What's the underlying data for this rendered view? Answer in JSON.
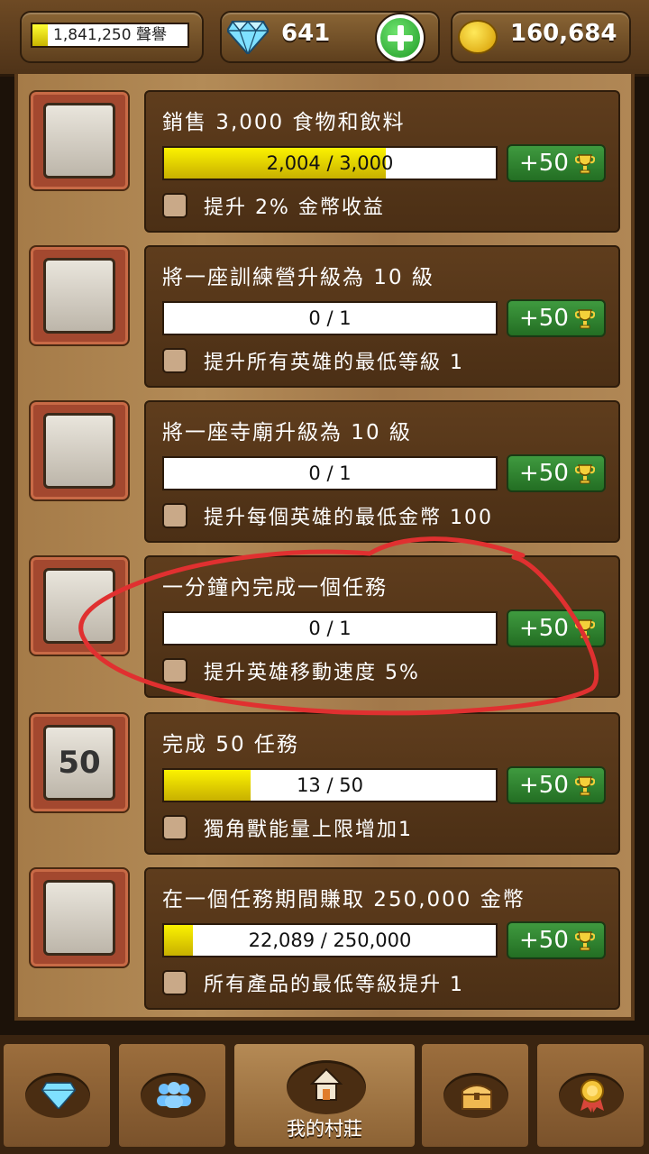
{
  "hud": {
    "reputation_text": "1,841,250 聲譽",
    "reputation_fill": 0.1,
    "gems": "641",
    "gold": "160,684",
    "gem_icon": "diamond-icon",
    "add_icon": "plus-icon",
    "gold_icon": "coin-icon"
  },
  "achievements": [
    {
      "icon": "beer-and-drumstick-icon",
      "title": "銷售 3,000 食物和飲料",
      "progress_text": "2,004 / 3,000",
      "progress": 0.668,
      "reward": "+50",
      "perk": "提升 2% 金幣收益"
    },
    {
      "icon": "barracks-icon",
      "title": "將一座訓練營升級為 10 級",
      "progress_text": "0 / 1",
      "progress": 0,
      "reward": "+50",
      "perk": "提升所有英雄的最低等級 1"
    },
    {
      "icon": "temple-icon",
      "title": "將一座寺廟升級為 10 級",
      "progress_text": "0 / 1",
      "progress": 0,
      "reward": "+50",
      "perk": "提升每個英雄的最低金幣 100"
    },
    {
      "icon": "hourglass-scroll-icon",
      "title": "一分鐘內完成一個任務",
      "progress_text": "0 / 1",
      "progress": 0,
      "reward": "+50",
      "perk": "提升英雄移動速度 5%"
    },
    {
      "icon": "scroll-50-icon",
      "title": "完成 50 任務",
      "progress_text": "13 / 50",
      "progress": 0.26,
      "reward": "+50",
      "perk": "獨角獸能量上限增加1",
      "art_text": "50"
    },
    {
      "icon": "coins-scroll-icon",
      "title": "在一個任務期間賺取 250,000 金幣",
      "progress_text": "22,089 / 250,000",
      "progress": 0.088,
      "reward": "+50",
      "perk": "所有產品的最低等級提升 1"
    }
  ],
  "nav": {
    "items": [
      {
        "icon": "diamond-icon"
      },
      {
        "icon": "people-icon"
      },
      {
        "icon": "house-icon",
        "label": "我的村莊",
        "active": true
      },
      {
        "icon": "treasure-chest-icon"
      },
      {
        "icon": "medal-icon"
      }
    ]
  },
  "colors": {
    "accent_green": "#2f8a2f",
    "progress_yellow": "#f5e900",
    "annotation_red": "#e03030"
  }
}
